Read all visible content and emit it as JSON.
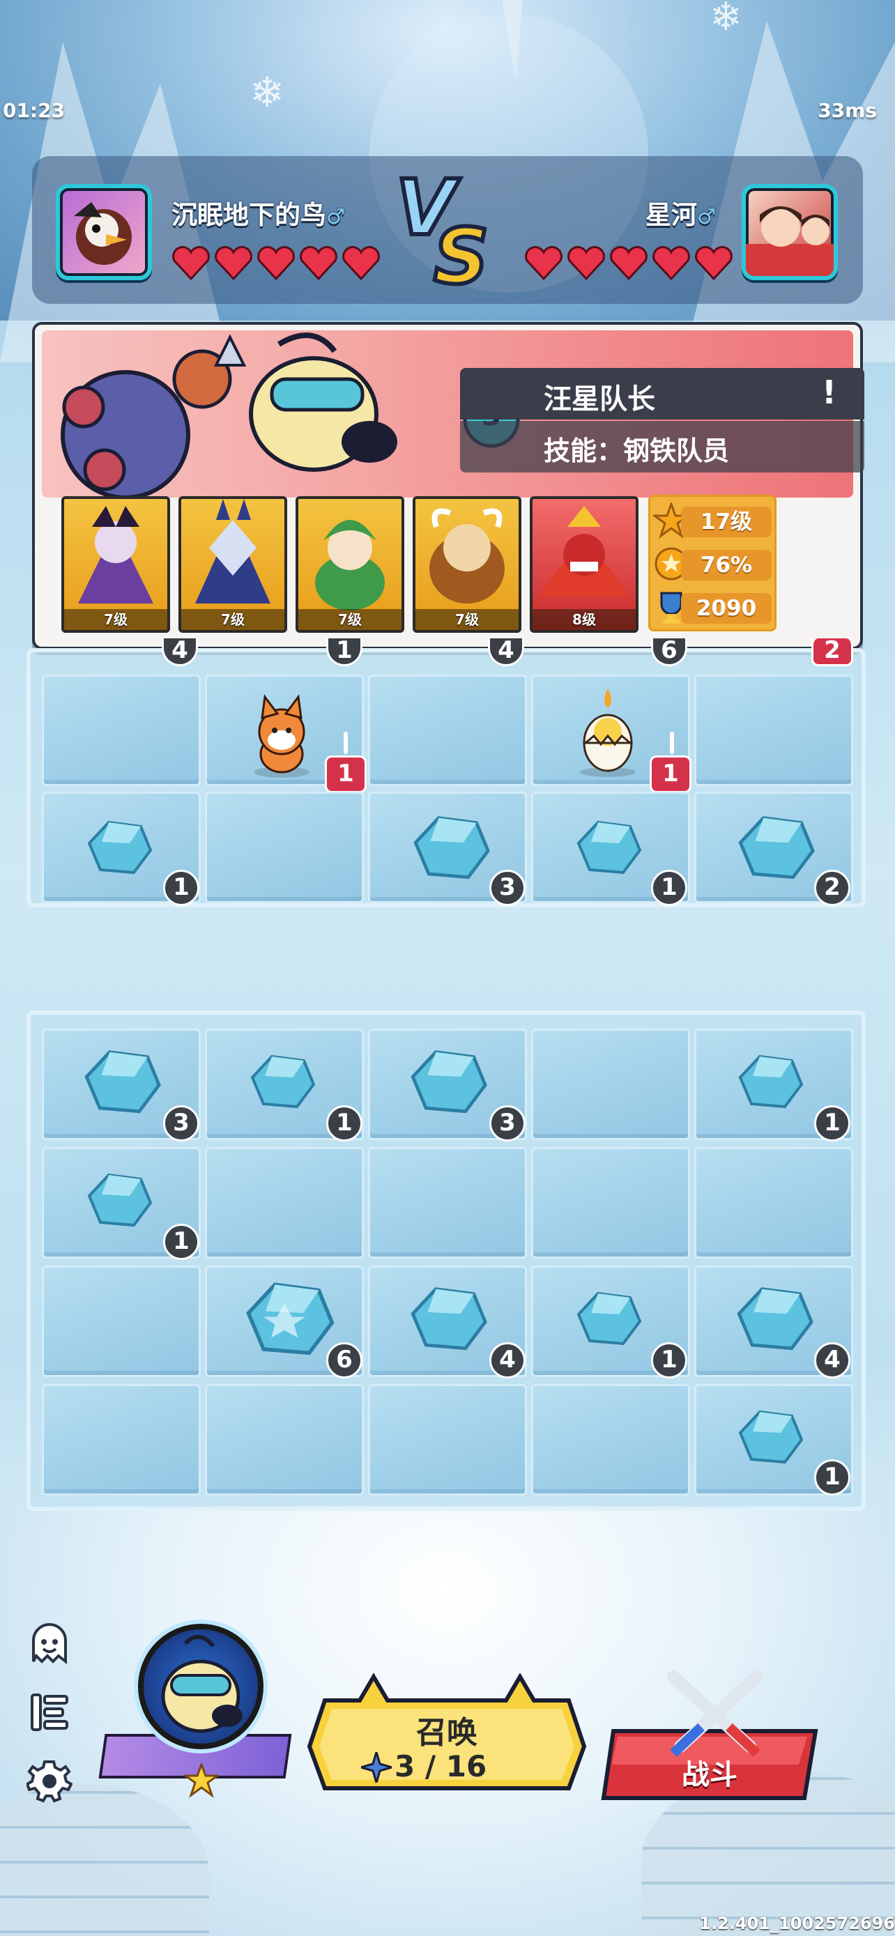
{
  "status": {
    "time": "01:23",
    "ping": "33ms"
  },
  "players": {
    "left": {
      "name": "沉眠地下的鸟",
      "gender": "♂",
      "hearts": 5
    },
    "right": {
      "name": "星河",
      "gender": "♂",
      "hearts": 5
    }
  },
  "vs_label": "VS",
  "hero_card": {
    "cost": "3",
    "name": "汪星队长",
    "skill": "技能：钢铁队员",
    "info_icon": "!",
    "units": [
      {
        "level": "7级",
        "icon": "vampire-lady-icon",
        "color": "#6a3fa0"
      },
      {
        "level": "7级",
        "icon": "wolf-warrior-icon",
        "color": "#2f3c8a"
      },
      {
        "level": "7级",
        "icon": "forest-dryad-icon",
        "color": "#3f9a4a"
      },
      {
        "level": "7级",
        "icon": "ox-knight-icon",
        "color": "#a05a20"
      },
      {
        "level": "8级",
        "icon": "red-dragon-icon",
        "color": "#c92a2a"
      }
    ],
    "stats": {
      "level": "17级",
      "win_rate": "76%",
      "trophies": "2090"
    }
  },
  "enemy_board": {
    "top_row_counts": [
      "4",
      "1",
      "4",
      "6",
      "2"
    ],
    "units": [
      {
        "col": 1,
        "icon": "fox-icon",
        "count": "1"
      },
      {
        "col": 3,
        "icon": "egg-chick-icon",
        "count": "1"
      }
    ],
    "ice_row": [
      "1",
      "",
      "3",
      "1",
      "2"
    ],
    "ice_present": [
      true,
      false,
      true,
      true,
      true
    ]
  },
  "player_board": {
    "rows": [
      [
        "3",
        "1",
        "3",
        "",
        "1"
      ],
      [
        "1",
        "",
        "",
        "",
        ""
      ],
      [
        "",
        "6",
        "4",
        "1",
        "4"
      ],
      [
        "",
        "",
        "",
        "",
        "1"
      ]
    ]
  },
  "controls": {
    "summon_label": "召唤",
    "summon_count": "3 / 16",
    "fight_label": "战斗",
    "version": "1.2.401_1002572696"
  },
  "colors": {
    "accent_yellow": "#f7d23c",
    "fight_red": "#d9343c",
    "badge_red": "#d4324a",
    "heart_red": "#e8334a"
  }
}
